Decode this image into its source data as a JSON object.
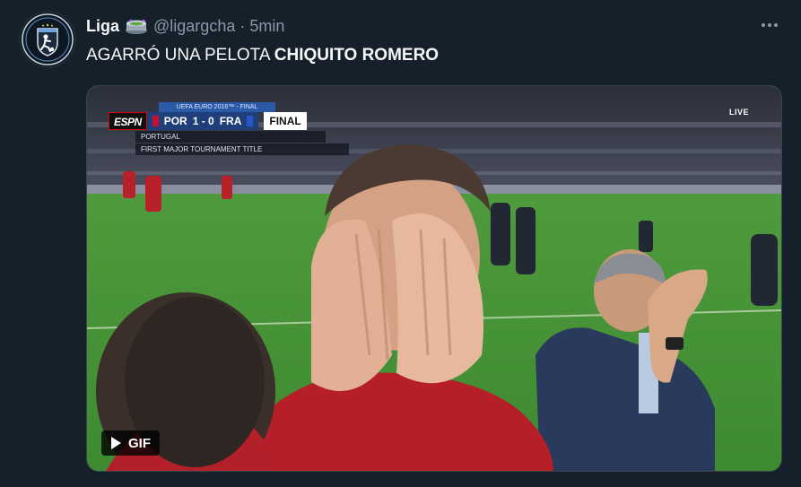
{
  "author": {
    "display_name": "Liga",
    "emoji_icon": "stadium-icon",
    "handle": "@ligargcha",
    "separator": "·",
    "time": "5min"
  },
  "tweet": {
    "text_plain": "AGARRÓ UNA PELOTA ",
    "text_bold": "CHIQUITO ROMERO"
  },
  "media": {
    "type": "gif",
    "badge_label": "GIF",
    "scorebug": {
      "logo": "ESPN",
      "tournament": "UEFA EURO 2016™ - FINAL",
      "team_home": "POR",
      "score": "1 - 0",
      "team_away": "FRA",
      "status": "FINAL",
      "line1": "PORTUGAL",
      "line2": "FIRST MAJOR TOURNAMENT TITLE"
    },
    "live_label": "LIVE"
  },
  "colors": {
    "background": "#15202b",
    "text_primary": "#f7f9f9",
    "text_secondary": "#8b98a5",
    "border": "#38444d"
  }
}
